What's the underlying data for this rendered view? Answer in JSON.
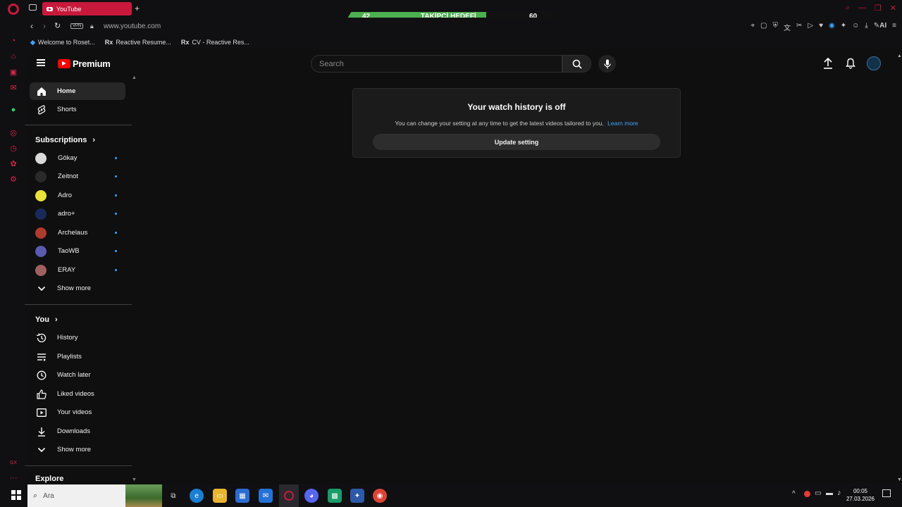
{
  "browser": {
    "tab_title": "YouTube",
    "url": "www.youtube.com",
    "vpn_label": "VPN",
    "bookmarks": [
      {
        "icon": "bookmark-globe-icon",
        "label": "Welcome to Roset..."
      },
      {
        "icon": "rx-icon",
        "label": "Reactive Resume..."
      },
      {
        "icon": "rx-icon",
        "label": "CV - Reactive Res..."
      }
    ],
    "ai_label": "AI"
  },
  "overlay": {
    "current": "42",
    "label": "TAKİPÇİ HEDEFİ",
    "goal": "60"
  },
  "youtube": {
    "logo_text": "Premium",
    "search_placeholder": "Search",
    "guide": {
      "home": "Home",
      "shorts": "Shorts",
      "subscriptions_heading": "Subscriptions",
      "subscriptions": [
        {
          "name": "Gökay",
          "avatar_color": "#d9d9d9"
        },
        {
          "name": "Zeitnot",
          "avatar_color": "#2a2a2a"
        },
        {
          "name": "Adro",
          "avatar_color": "#e8e23a"
        },
        {
          "name": "adro+",
          "avatar_color": "#1a2a5a"
        },
        {
          "name": "Archelaus",
          "avatar_color": "#b03a2e"
        },
        {
          "name": "TaoWB",
          "avatar_color": "#5a5ab0"
        },
        {
          "name": "ERAY",
          "avatar_color": "#a06060"
        }
      ],
      "show_more_1": "Show more",
      "you_heading": "You",
      "you_items": [
        {
          "label": "History",
          "icon": "history-icon"
        },
        {
          "label": "Playlists",
          "icon": "playlists-icon"
        },
        {
          "label": "Watch later",
          "icon": "watch-later-icon"
        },
        {
          "label": "Liked videos",
          "icon": "thumbs-up-icon"
        },
        {
          "label": "Your videos",
          "icon": "your-videos-icon"
        },
        {
          "label": "Downloads",
          "icon": "download-icon"
        }
      ],
      "show_more_2": "Show more",
      "explore_heading": "Explore"
    },
    "history_card": {
      "title": "Your watch history is off",
      "body": "You can change your setting at any time to get the latest videos tailored to you.",
      "link": "Learn more",
      "button": "Update setting"
    }
  },
  "taskbar": {
    "search_placeholder": "Ara",
    "time": "00:05",
    "date": "27.03.2026"
  },
  "colors": {
    "opera_red": "#c8193c",
    "youtube_red": "#ff0000",
    "link_blue": "#3ea6ff",
    "overlay_green": "#4caf50"
  }
}
